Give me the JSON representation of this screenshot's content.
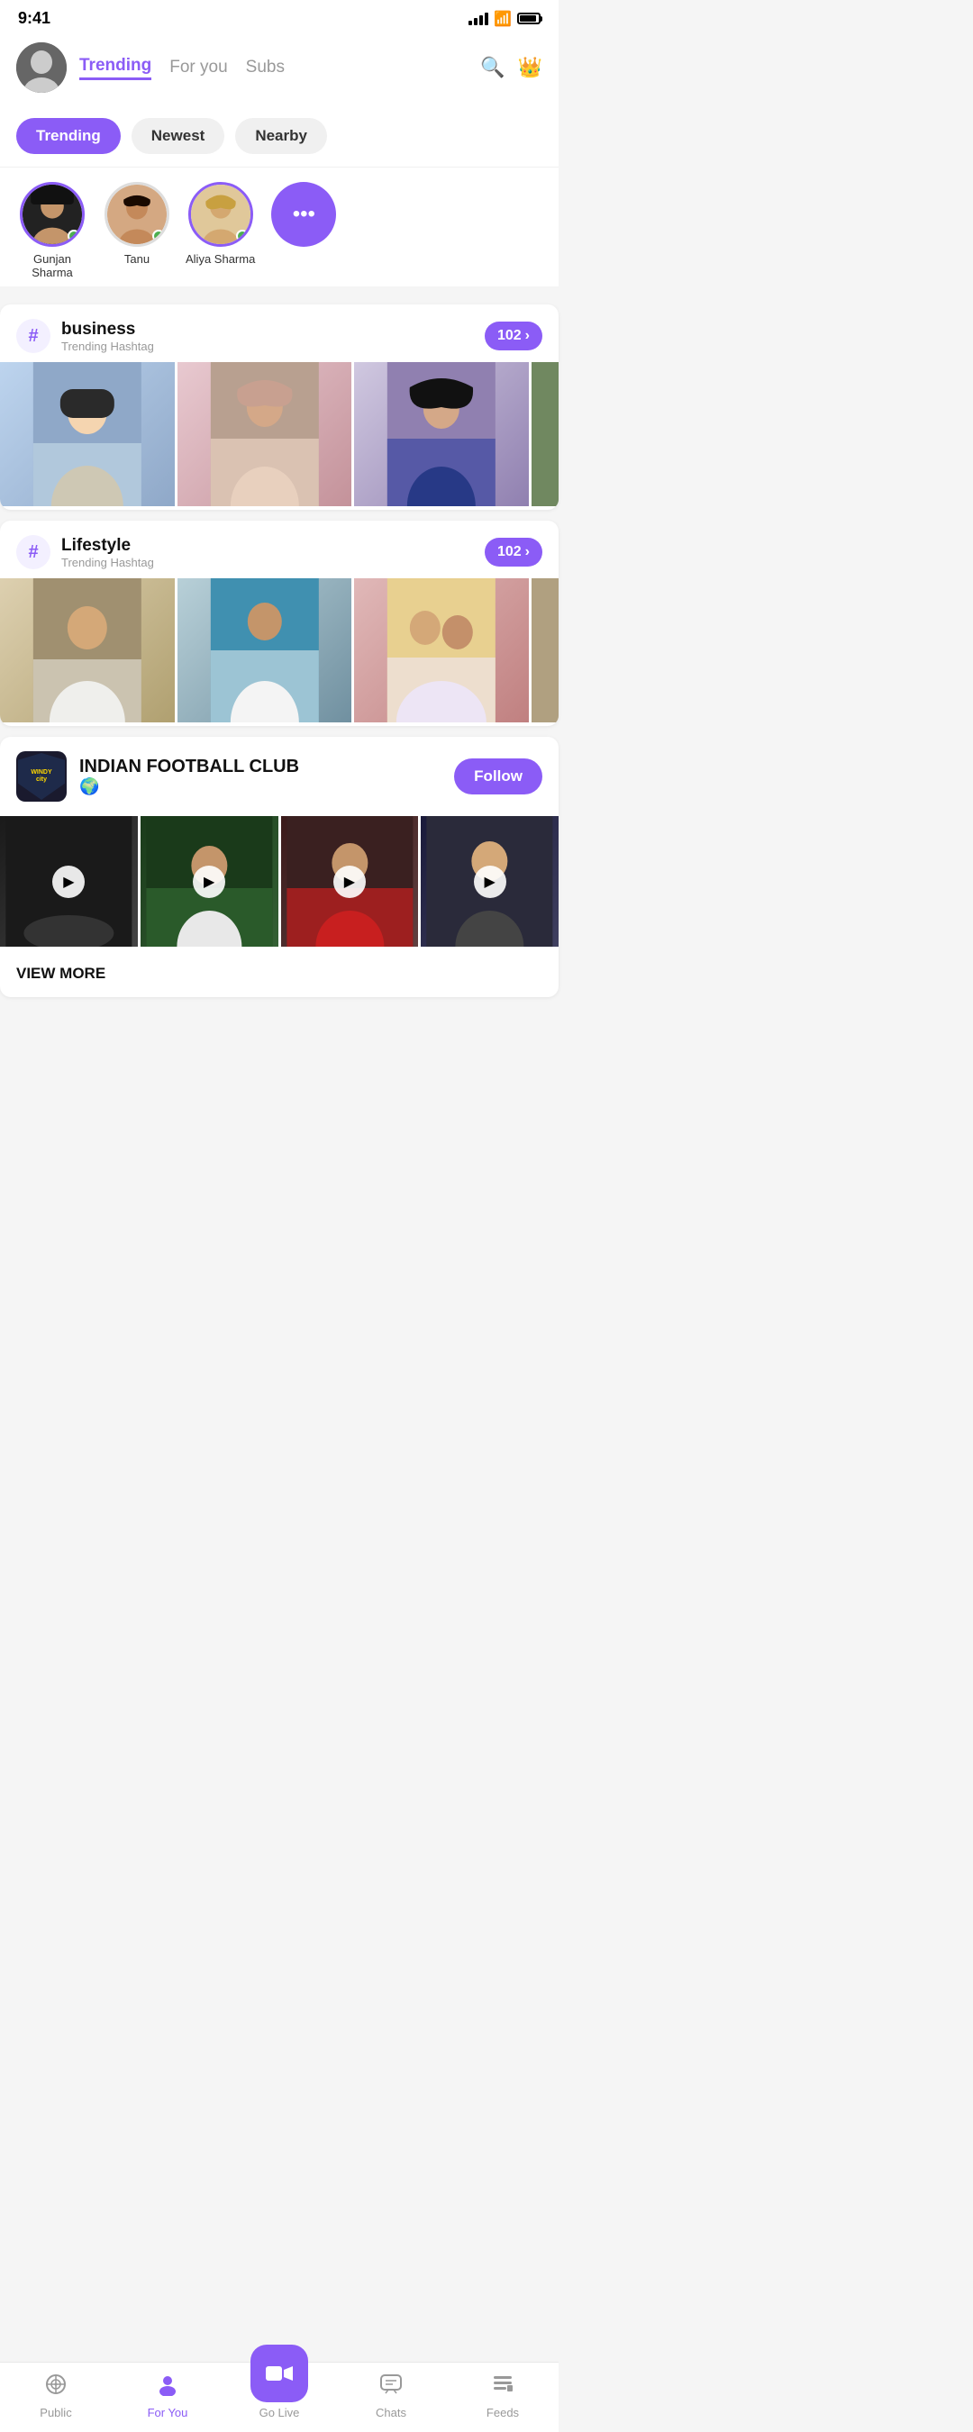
{
  "statusBar": {
    "time": "9:41"
  },
  "header": {
    "tabs": [
      {
        "id": "trending",
        "label": "Trending",
        "active": true
      },
      {
        "id": "for-you",
        "label": "For you",
        "active": false
      },
      {
        "id": "subs",
        "label": "Subs",
        "active": false
      }
    ],
    "searchIcon": "🔍",
    "crownIcon": "👑"
  },
  "filterBar": {
    "buttons": [
      {
        "label": "Trending",
        "active": true
      },
      {
        "label": "Newest",
        "active": false
      },
      {
        "label": "Nearby",
        "active": false
      }
    ]
  },
  "stories": [
    {
      "name": "Gunjan Sharma",
      "online": true,
      "ring": true
    },
    {
      "name": "Tanu",
      "online": true,
      "ring": false
    },
    {
      "name": "Aliya Sharma",
      "online": true,
      "ring": true
    }
  ],
  "moreButton": "•••",
  "hashtags": [
    {
      "tag": "business",
      "subtitle": "Trending Hashtag",
      "count": "102",
      "images": [
        "img1",
        "img2",
        "img3",
        "img4"
      ]
    },
    {
      "tag": "Lifestyle",
      "subtitle": "Trending Hashtag",
      "count": "102",
      "images": [
        "img5",
        "img6",
        "img7",
        "img8"
      ]
    }
  ],
  "club": {
    "logoText": "WINDY city",
    "name": "INDIAN FOOTBALL CLUB",
    "globe": "🌍",
    "followLabel": "Follow",
    "viewMoreLabel": "VIEW MORE",
    "videos": [
      "v1",
      "v2",
      "v3",
      "v4"
    ]
  },
  "bottomNav": {
    "items": [
      {
        "icon": "📡",
        "label": "Public",
        "active": false
      },
      {
        "icon": "👤",
        "label": "For You",
        "active": true
      },
      {
        "icon": "🎥",
        "label": "Go Live",
        "active": false,
        "special": true
      },
      {
        "icon": "💬",
        "label": "Chats",
        "active": false
      },
      {
        "icon": "≡",
        "label": "Feeds",
        "active": false
      }
    ]
  }
}
